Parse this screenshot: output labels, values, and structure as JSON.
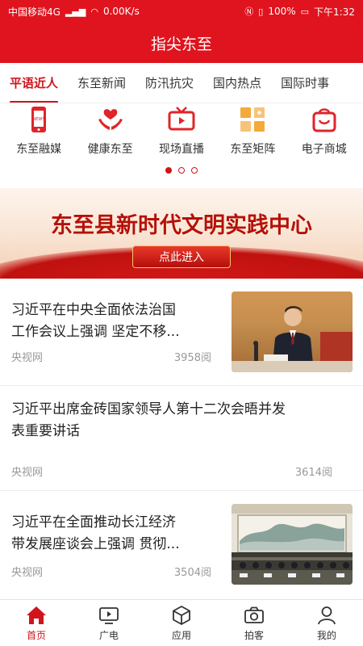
{
  "status_bar": {
    "carrier": "中国移动4G",
    "network_speed": "0.00K/s",
    "battery": "100%",
    "time": "下午1:32"
  },
  "header": {
    "title": "指尖东至"
  },
  "tabs": [
    {
      "label": "平语近人",
      "active": true
    },
    {
      "label": "东至新闻"
    },
    {
      "label": "防汛抗灾"
    },
    {
      "label": "国内热点"
    },
    {
      "label": "国际时事"
    }
  ],
  "quick_links": [
    {
      "label": "东至融媒",
      "icon": "phone-news-icon"
    },
    {
      "label": "健康东至",
      "icon": "health-hands-icon"
    },
    {
      "label": "现场直播",
      "icon": "live-tv-icon"
    },
    {
      "label": "东至矩阵",
      "icon": "matrix-grid-icon"
    },
    {
      "label": "电子商城",
      "icon": "shopping-bag-icon"
    }
  ],
  "carousel": {
    "pages": 3,
    "current": 1
  },
  "banner": {
    "title": "东至县新时代文明实践中心",
    "button_label": "点此进入"
  },
  "news": [
    {
      "title_line1": "习近平在中央全面依法治国",
      "title_line2": "工作会议上强调 坚定不移...",
      "source": "央视网",
      "reads": "3958阅"
    },
    {
      "title_line1": "习近平出席金砖国家领导人第十二次会晤并发",
      "title_line2": "表重要讲话",
      "source": "央视网",
      "reads": "3614阅"
    },
    {
      "title_line1": "习近平在全面推动长江经济",
      "title_line2": "带发展座谈会上强调 贯彻...",
      "source": "央视网",
      "reads": "3504阅"
    }
  ],
  "bottom_nav": [
    {
      "label": "首页",
      "icon": "home-icon",
      "active": true
    },
    {
      "label": "广电",
      "icon": "tv-icon"
    },
    {
      "label": "应用",
      "icon": "box-icon"
    },
    {
      "label": "拍客",
      "icon": "camera-icon"
    },
    {
      "label": "我的",
      "icon": "user-icon"
    }
  ],
  "colors": {
    "brand_red": "#e0141e",
    "accent_red": "#d0141c",
    "meta_gray": "#999999"
  }
}
